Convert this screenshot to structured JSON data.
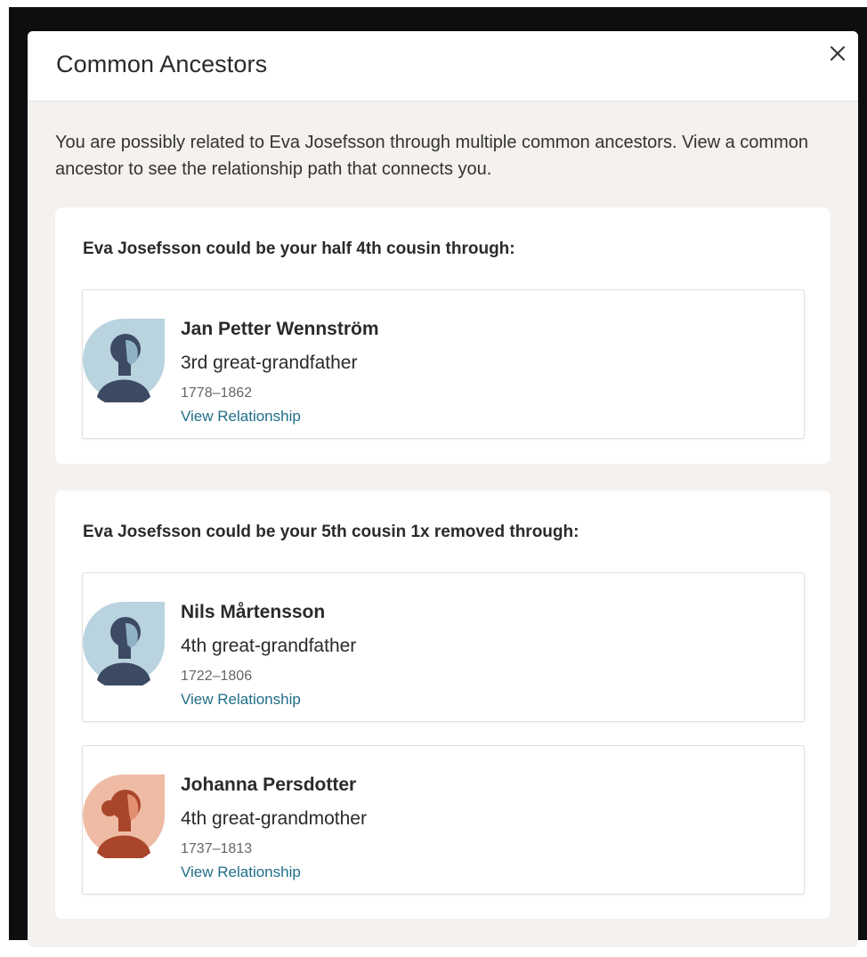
{
  "modal": {
    "title": "Common Ancestors",
    "close_icon": "close-icon",
    "intro": "You are possibly related to Eva Josefsson through multiple common ancestors. View a common ancestor to see the relationship path that connects you."
  },
  "groups": [
    {
      "heading": "Eva Josefsson could be your half 4th cousin through:",
      "people": [
        {
          "name": "Jan Petter Wennström",
          "relationship": "3rd great-grandfather",
          "dates": "1778–1862",
          "link": "View Relationship",
          "avatar_icon": "male-avatar-icon"
        }
      ]
    },
    {
      "heading": "Eva Josefsson could be your 5th cousin 1x removed through:",
      "people": [
        {
          "name": "Nils Mårtensson",
          "relationship": "4th great-grandfather",
          "dates": "1722–1806",
          "link": "View Relationship",
          "avatar_icon": "male-avatar-icon"
        },
        {
          "name": "Johanna Persdotter",
          "relationship": "4th great-grandmother",
          "dates": "1737–1813",
          "link": "View Relationship",
          "avatar_icon": "female-avatar-icon"
        }
      ]
    }
  ],
  "colors": {
    "male_avatar_bg": "#b9d3df",
    "male_avatar_figure": "#3c4a63",
    "female_avatar_bg": "#efbba4",
    "female_avatar_figure": "#a8452b",
    "link": "#1f6e86"
  }
}
